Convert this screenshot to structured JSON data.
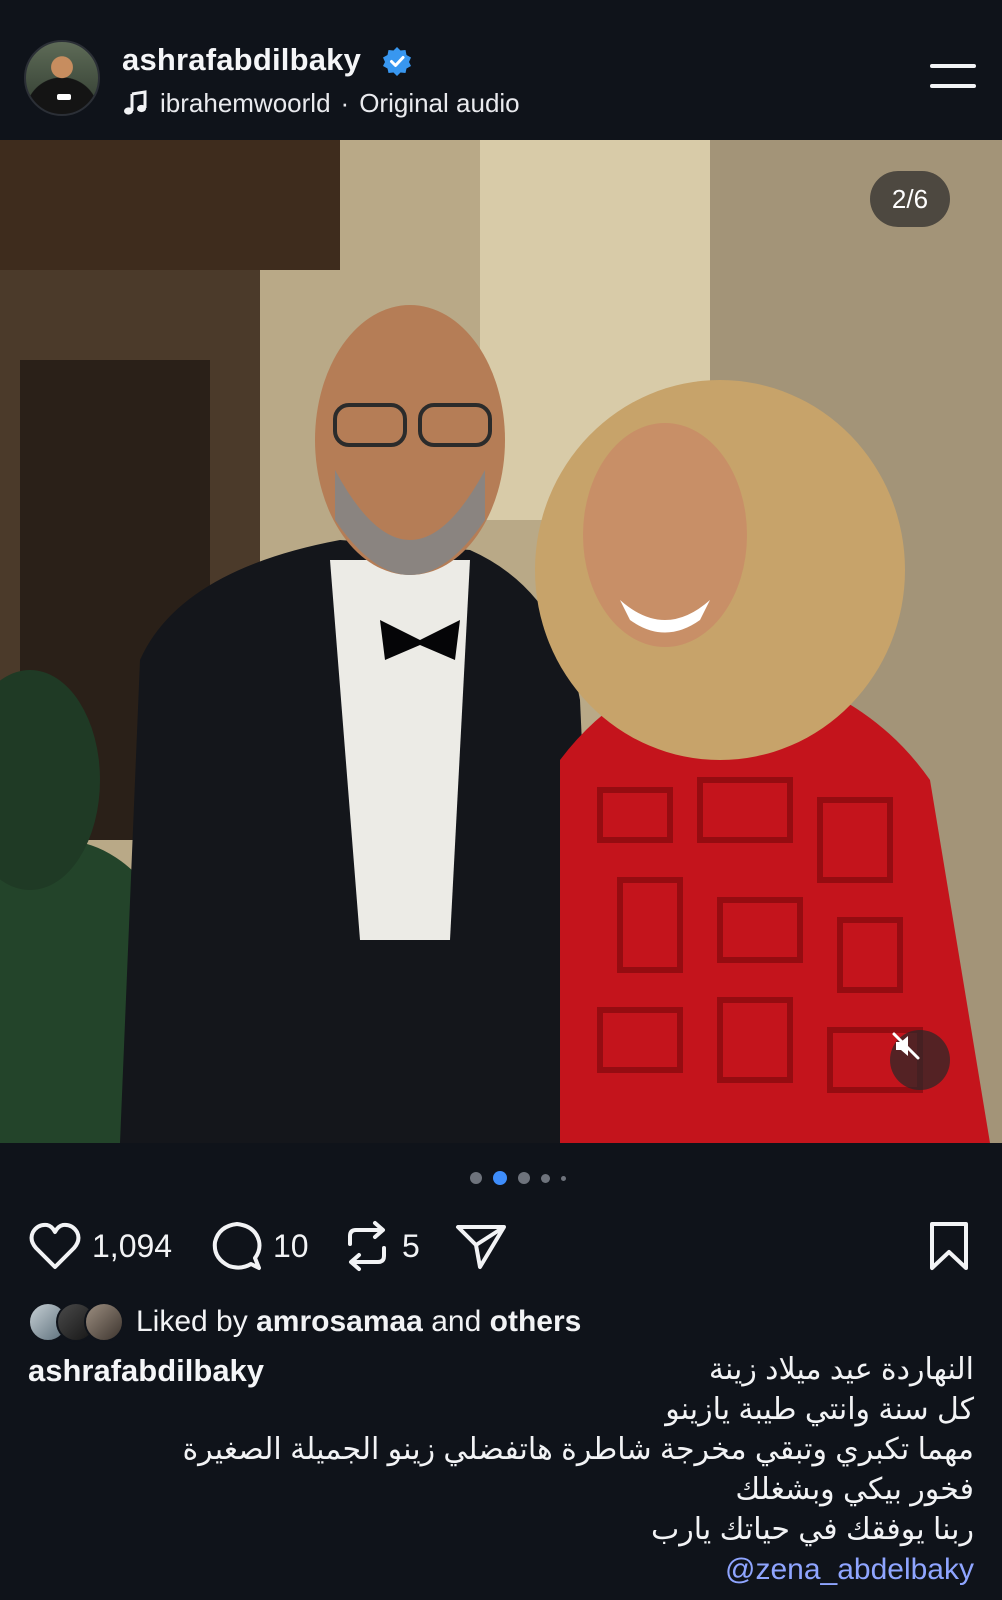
{
  "header": {
    "username": "ashrafabdilbaky",
    "verified": true,
    "audio_author": "ibrahemwoorld",
    "audio_separator": "·",
    "audio_label": "Original audio"
  },
  "media": {
    "counter": "2/6",
    "muted": true,
    "current_index": 2,
    "total_dots": 5
  },
  "actions": {
    "likes": "1,094",
    "comments": "10",
    "reposts": "5"
  },
  "liked_by": {
    "prefix": "Liked by",
    "user": "amrosamaa",
    "connector": "and",
    "suffix": "others"
  },
  "caption": {
    "username": "ashrafabdilbaky",
    "lines": [
      "النهاردة عيد ميلاد زينة",
      "كل سنة وانتي طيبة يازينو",
      "مهما تكبري وتبقي مخرجة شاطرة هاتفضلي زينو الجميلة الصغيرة",
      "فخور بيكي وبشغلك",
      "ربنا يوفقك في حياتك يارب"
    ],
    "mention": "@zena_abdelbaky"
  },
  "colors": {
    "background": "#0f131a",
    "verified": "#3897f0",
    "mention": "#8fa5ff",
    "dress": "#c4141c"
  },
  "icons": [
    "music-icon",
    "verified-badge-icon",
    "menu-icon",
    "heart-icon",
    "comment-icon",
    "repost-icon",
    "share-icon",
    "bookmark-icon",
    "mute-icon"
  ]
}
